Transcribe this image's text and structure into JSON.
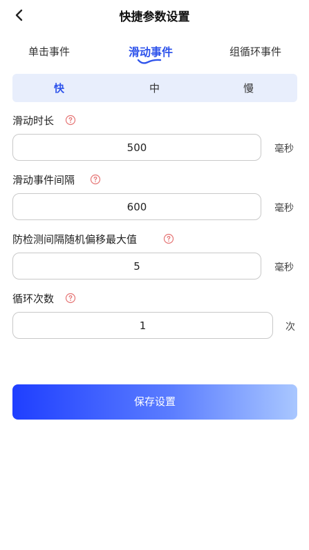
{
  "header": {
    "title": "快捷参数设置"
  },
  "event_tabs": [
    {
      "label": "单击事件",
      "active": false
    },
    {
      "label": "滑动事件",
      "active": true
    },
    {
      "label": "组循环事件",
      "active": false
    }
  ],
  "speed_options": [
    {
      "label": "快",
      "selected": true
    },
    {
      "label": "中",
      "selected": false
    },
    {
      "label": "慢",
      "selected": false
    }
  ],
  "fields": {
    "duration": {
      "label": "滑动时长",
      "value": "500",
      "unit": "毫秒"
    },
    "interval": {
      "label": "滑动事件间隔",
      "value": "600",
      "unit": "毫秒"
    },
    "random_offset": {
      "label": "防检测间隔随机偏移最大值",
      "value": "5",
      "unit": "毫秒"
    },
    "loop_count": {
      "label": "循环次数",
      "value": "1",
      "unit": "次"
    }
  },
  "save_button": {
    "label": "保存设置"
  },
  "colors": {
    "accent": "#2f54eb",
    "speed_bg": "#e8eefc",
    "help_icon": "#e57373"
  }
}
